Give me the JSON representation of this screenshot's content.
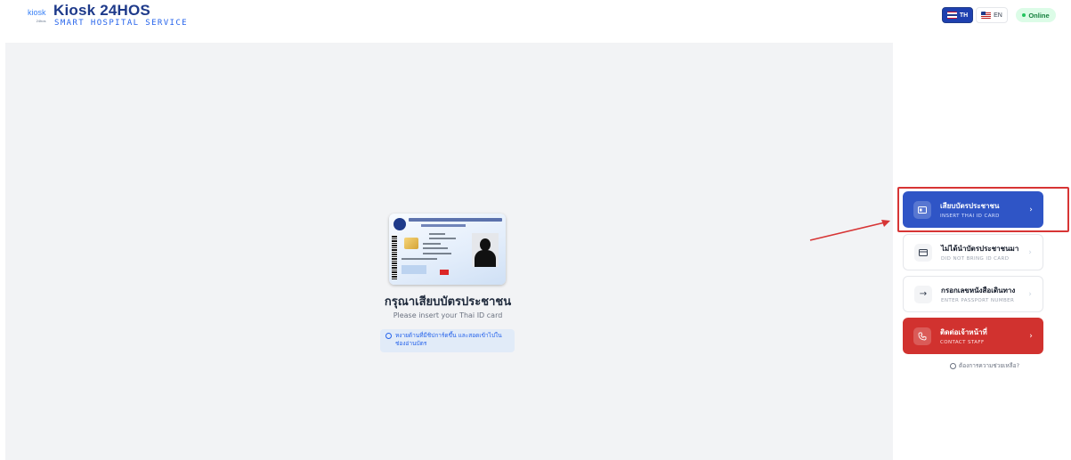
{
  "header": {
    "logo_text": "kiosk",
    "logo_sub": "24hos",
    "title": "Kiosk 24HOS",
    "subtitle": "SMART HOSPITAL SERVICE",
    "lang_th": "TH",
    "lang_en": "EN",
    "status": "Online"
  },
  "main": {
    "title": "กรุณาเสียบบัตรประชาชน",
    "subtitle": "Please insert your Thai ID card",
    "hint": "หงายด้านที่มีชิปการ์ดขึ้น และสอดเข้าไปในช่องอ่านบัตร"
  },
  "sidebar": {
    "options": [
      {
        "label": "เสียบบัตรประชาชน",
        "sub": "INSERT THAI ID CARD",
        "icon": "id-card-icon"
      },
      {
        "label": "ไม่ได้นำบัตรประชาชนมา",
        "sub": "DID NOT BRING ID CARD",
        "icon": "card-icon"
      },
      {
        "label": "กรอกเลขหนังสือเดินทาง",
        "sub": "ENTER PASSPORT NUMBER",
        "icon": "arrow-right-icon"
      },
      {
        "label": "ติดต่อเจ้าหน้าที่",
        "sub": "CONTACT STAFF",
        "icon": "phone-icon"
      }
    ],
    "help": "ต้องการความช่วยเหลือ?"
  },
  "colors": {
    "primary": "#2f55c6",
    "danger": "#d1322f",
    "online": "#22c55e",
    "annotation": "#d73535"
  }
}
